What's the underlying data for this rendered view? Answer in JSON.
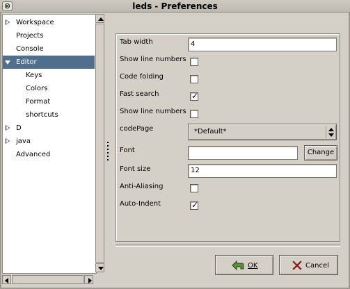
{
  "window": {
    "title": "leds - Preferences",
    "close_glyph": "⊗"
  },
  "tree": {
    "items": [
      {
        "label": "Workspace",
        "expander": "collapsed"
      },
      {
        "label": "Projects"
      },
      {
        "label": "Console"
      },
      {
        "label": "Editor",
        "expander": "expanded",
        "selected": true
      },
      {
        "label": "Keys"
      },
      {
        "label": "Colors"
      },
      {
        "label": "Format"
      },
      {
        "label": "shortcuts"
      },
      {
        "label": "D",
        "expander": "collapsed"
      },
      {
        "label": "java",
        "expander": "collapsed"
      },
      {
        "label": "Advanced"
      }
    ]
  },
  "form": {
    "tab_width": {
      "label": "Tab width",
      "value": "4"
    },
    "show_line_numbers_1": {
      "label": "Show line numbers",
      "checked": false
    },
    "code_folding": {
      "label": "Code folding",
      "checked": false
    },
    "fast_search": {
      "label": "Fast search",
      "checked": true
    },
    "show_line_numbers_2": {
      "label": "Show line numbers",
      "checked": false
    },
    "codepage": {
      "label": "codePage",
      "value": "*Default*"
    },
    "font": {
      "label": "Font",
      "value": "",
      "change_label": "Change"
    },
    "font_size": {
      "label": "Font size",
      "value": "12"
    },
    "anti_aliasing": {
      "label": "Anti-Aliasing",
      "checked": false
    },
    "auto_indent": {
      "label": "Auto-Indent",
      "checked": true
    }
  },
  "buttons": {
    "ok_label": "OK",
    "cancel_label": "Cancel"
  },
  "colors": {
    "selection": "#506f8f",
    "window_bg": "#d4d0c8",
    "ok_icon_green": "#5f8f3a",
    "cancel_icon_red": "#c0281c"
  },
  "glyphs": {
    "checkmark": "✓"
  }
}
